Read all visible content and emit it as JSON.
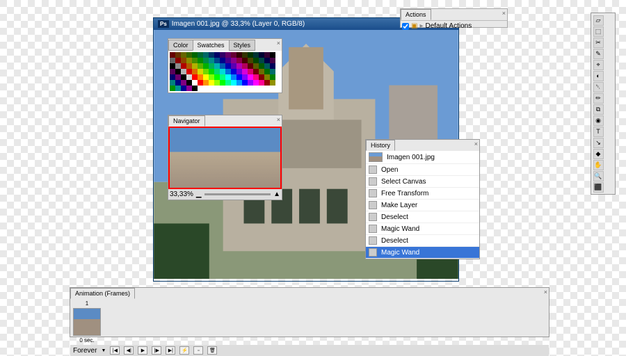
{
  "document": {
    "icon": "Ps",
    "title": "Imagen 001.jpg @ 33,3% (Layer 0, RGB/8)"
  },
  "actions": {
    "tab": "Actions",
    "defaultSet": "Default Actions"
  },
  "swatches": {
    "tabs": [
      "Color",
      "Swatches",
      "Styles"
    ]
  },
  "navigator": {
    "tab": "Navigator",
    "zoom": "33,33%"
  },
  "history": {
    "tab": "History",
    "docName": "Imagen 001.jpg",
    "items": [
      {
        "label": "Open",
        "selected": false
      },
      {
        "label": "Select Canvas",
        "selected": false
      },
      {
        "label": "Free Transform",
        "selected": false
      },
      {
        "label": "Make Layer",
        "selected": false
      },
      {
        "label": "Deselect",
        "selected": false
      },
      {
        "label": "Magic Wand",
        "selected": false
      },
      {
        "label": "Deselect",
        "selected": false
      },
      {
        "label": "Magic Wand",
        "selected": true
      }
    ]
  },
  "animation": {
    "tab": "Animation (Frames)",
    "frameTime": "0 sec.",
    "loop": "Forever"
  },
  "tools": [
    "▱",
    "⬚",
    "✂",
    "✎",
    "⌖",
    "◐",
    "␡",
    "✏",
    "⧉",
    "◉",
    "T",
    "↘",
    "◆",
    "✋",
    "🔍",
    "⬛"
  ]
}
